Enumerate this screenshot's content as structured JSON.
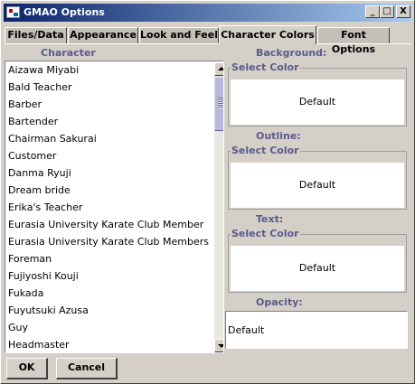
{
  "window": {
    "title": "GMAO Options"
  },
  "titlebar_buttons": {
    "minimize": "_",
    "maximize": "□",
    "close": "X"
  },
  "tabs": [
    {
      "label": "Files/Data",
      "active": false
    },
    {
      "label": "Appearance",
      "active": false
    },
    {
      "label": "Look and Feel",
      "active": false
    },
    {
      "label": "Character Colors",
      "active": true
    },
    {
      "label": "Font Options",
      "active": false
    }
  ],
  "character_column": {
    "header": "Character",
    "items": [
      "Aizawa Miyabi",
      "Bald Teacher",
      "Barber",
      "Bartender",
      "Chairman Sakurai",
      "Customer",
      "Danma Ryuji",
      "Dream bride",
      "Erika's Teacher",
      "Eurasia University Karate Club Member",
      "Eurasia University Karate Club Members",
      "Foreman",
      "Fujiyoshi Kouji",
      "Fukada",
      "Fuyutsuki Azusa",
      "Guy",
      "Headmaster"
    ]
  },
  "background": {
    "header": "Background:",
    "group_title": "Select Color",
    "value": "Default"
  },
  "outline": {
    "header": "Outline:",
    "group_title": "Select Color",
    "value": "Default"
  },
  "text": {
    "header": "Text:",
    "group_title": "Select Color",
    "value": "Default"
  },
  "opacity": {
    "header": "Opacity:",
    "value": "Default"
  },
  "buttons": {
    "ok": "OK",
    "cancel": "Cancel"
  },
  "colors": {
    "title_start": "#0a246a",
    "title_end": "#a6caf0",
    "label": "#5a5a8c",
    "face": "#d4d0c8"
  }
}
